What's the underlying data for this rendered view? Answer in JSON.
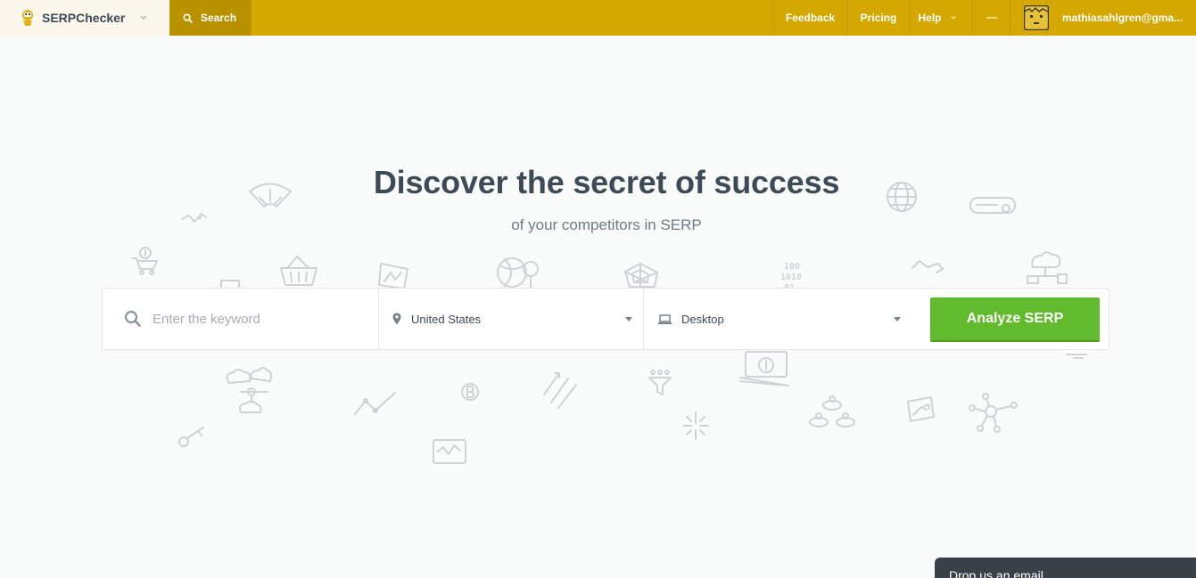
{
  "brand": {
    "name": "SERPChecker",
    "logo_icon": "serpchecker-logo-icon"
  },
  "topbar": {
    "search_tab": "Search",
    "nav": {
      "feedback": "Feedback",
      "pricing": "Pricing",
      "help": "Help"
    },
    "user_email": "mathiasahlgren@gma..."
  },
  "hero": {
    "title": "Discover the secret of success",
    "subtitle": "of your competitors in SERP"
  },
  "search_form": {
    "keyword_placeholder": "Enter the keyword",
    "keyword_value": "",
    "country": "United States",
    "device": "Desktop",
    "submit_label": "Analyze SERP"
  },
  "chat": {
    "label": "Drop us an email"
  },
  "colors": {
    "topbar": "#d4a800",
    "search_tab": "#b99200",
    "primary_button": "#62bb2d",
    "heading": "#3d4b57",
    "doodle": "#cfd3d6",
    "chat_tab": "#3b4148"
  }
}
